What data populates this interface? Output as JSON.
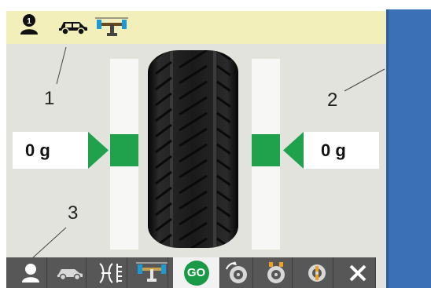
{
  "left_weight": {
    "value": "0 g"
  },
  "right_weight": {
    "value": "0 g"
  },
  "callouts": {
    "one": "1",
    "two": "2",
    "three": "3"
  },
  "status_bar": {
    "icons": [
      "user-number-icon",
      "car-icon",
      "axle-icon"
    ],
    "user_number": "1"
  },
  "toolbar": {
    "buttons": [
      {
        "icon": "user-icon"
      },
      {
        "icon": "car-icon"
      },
      {
        "icon": "rim-dimensions-icon"
      },
      {
        "icon": "axle-icon"
      },
      {
        "icon": "go-icon",
        "label": "GO",
        "selected": true
      },
      {
        "icon": "wheel-spin-icon"
      },
      {
        "icon": "wheel-weights-icon"
      },
      {
        "icon": "wheel-center-icon"
      },
      {
        "icon": "close-icon"
      }
    ]
  },
  "colors": {
    "status_bar": "#f3efbb",
    "background": "#e3e3de",
    "accent_green": "#1fa24b",
    "side_panel": "#3b6fb6",
    "toolbar": "#575757"
  }
}
